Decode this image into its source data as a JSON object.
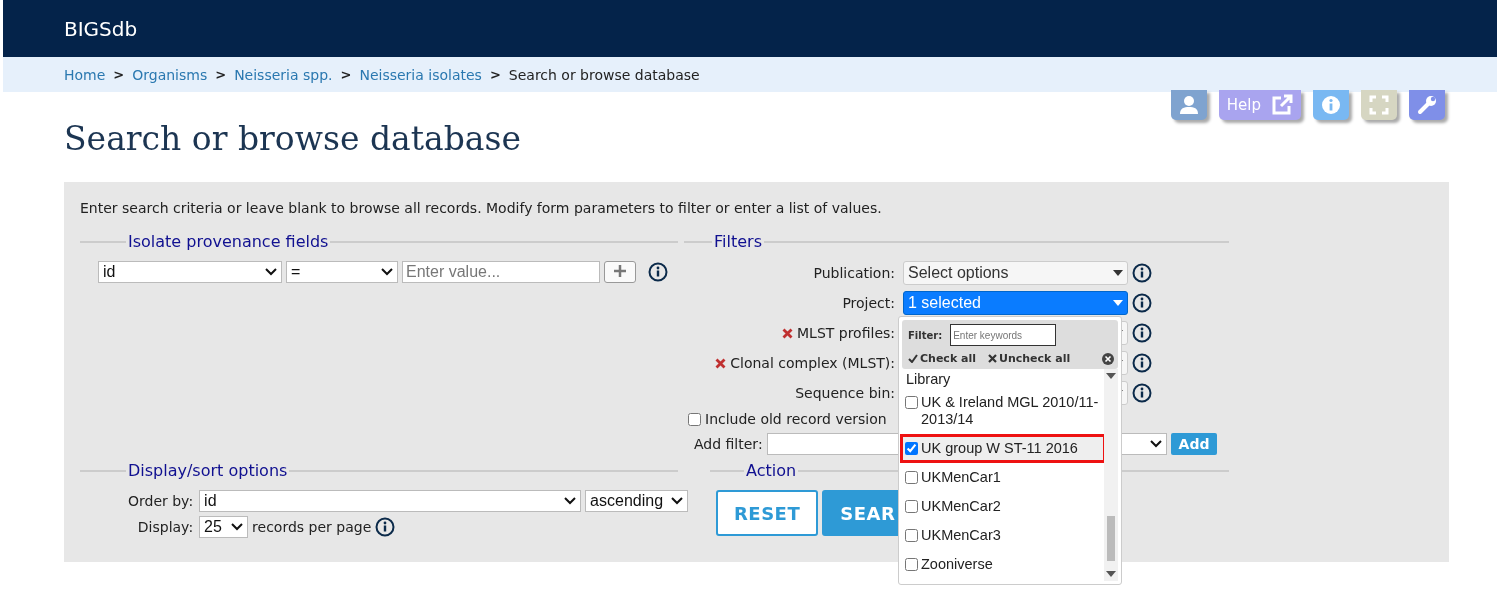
{
  "header": {
    "title": "BIGSdb"
  },
  "breadcrumb": [
    {
      "label": "Home",
      "link": true
    },
    {
      "label": "Organisms",
      "link": true
    },
    {
      "label": "Neisseria spp.",
      "link": true
    },
    {
      "label": "Neisseria isolates",
      "link": true
    },
    {
      "label": "Search or browse database",
      "link": false
    }
  ],
  "breadcrumb_separators": [
    ">",
    ">",
    ">",
    ">"
  ],
  "toolbar": [
    {
      "kind": "user"
    },
    {
      "kind": "help",
      "label": "Help"
    },
    {
      "kind": "info"
    },
    {
      "kind": "expand"
    },
    {
      "kind": "wrench"
    }
  ],
  "page_title": "Search or browse database",
  "form": {
    "intro": "Enter search criteria or leave blank to browse all records. Modify form parameters to filter or enter a list of values.",
    "provenance": {
      "legend": "Isolate provenance fields",
      "field": "id",
      "operator": "=",
      "placeholder": "Enter value..."
    },
    "filters": {
      "legend": "Filters",
      "rows": [
        {
          "kind": "select",
          "label": "Publication:",
          "value": "Select options",
          "active": false,
          "removable": false
        },
        {
          "kind": "select",
          "label": "Project:",
          "value": "1 selected",
          "active": true,
          "removable": false
        },
        {
          "kind": "select",
          "label": "MLST profiles:",
          "active": false,
          "removable": true
        },
        {
          "kind": "select",
          "label": "Clonal complex (MLST):",
          "active": false,
          "removable": true
        },
        {
          "kind": "select",
          "label": "Sequence bin:",
          "active": false,
          "removable": false
        },
        {
          "kind": "checkbox",
          "label": "Include old record version",
          "checked": false
        },
        {
          "kind": "add",
          "label": "Add filter:",
          "button": "Add"
        }
      ]
    },
    "display": {
      "legend": "Display/sort options",
      "order_label": "Order by:",
      "order": "id",
      "direction": "ascending",
      "display_label": "Display:",
      "display": "25",
      "suffix": "records per page"
    },
    "action": {
      "legend": "Action",
      "buttons": [
        {
          "label": "RESET",
          "kind": "outline"
        },
        {
          "label": "SEAR",
          "kind": "solid"
        }
      ]
    }
  },
  "project_popup": {
    "filter_label": "Filter:",
    "filter_placeholder": "Enter keywords",
    "check_all": "Check all",
    "uncheck_all": "Uncheck all",
    "items": [
      {
        "kind": "text",
        "label": "Library"
      },
      {
        "kind": "option",
        "label": "UK & Ireland MGL 2010/11-2013/14",
        "checked": false,
        "highlighted": false
      },
      {
        "kind": "option",
        "label": "UK group W ST-11 2016",
        "checked": true,
        "highlighted": true
      },
      {
        "kind": "option",
        "label": "UKMenCar1",
        "checked": false,
        "highlighted": false
      },
      {
        "kind": "option",
        "label": "UKMenCar2",
        "checked": false,
        "highlighted": false
      },
      {
        "kind": "option",
        "label": "UKMenCar3",
        "checked": false,
        "highlighted": false
      },
      {
        "kind": "option",
        "label": "Zooniverse",
        "checked": false,
        "highlighted": false
      }
    ]
  }
}
